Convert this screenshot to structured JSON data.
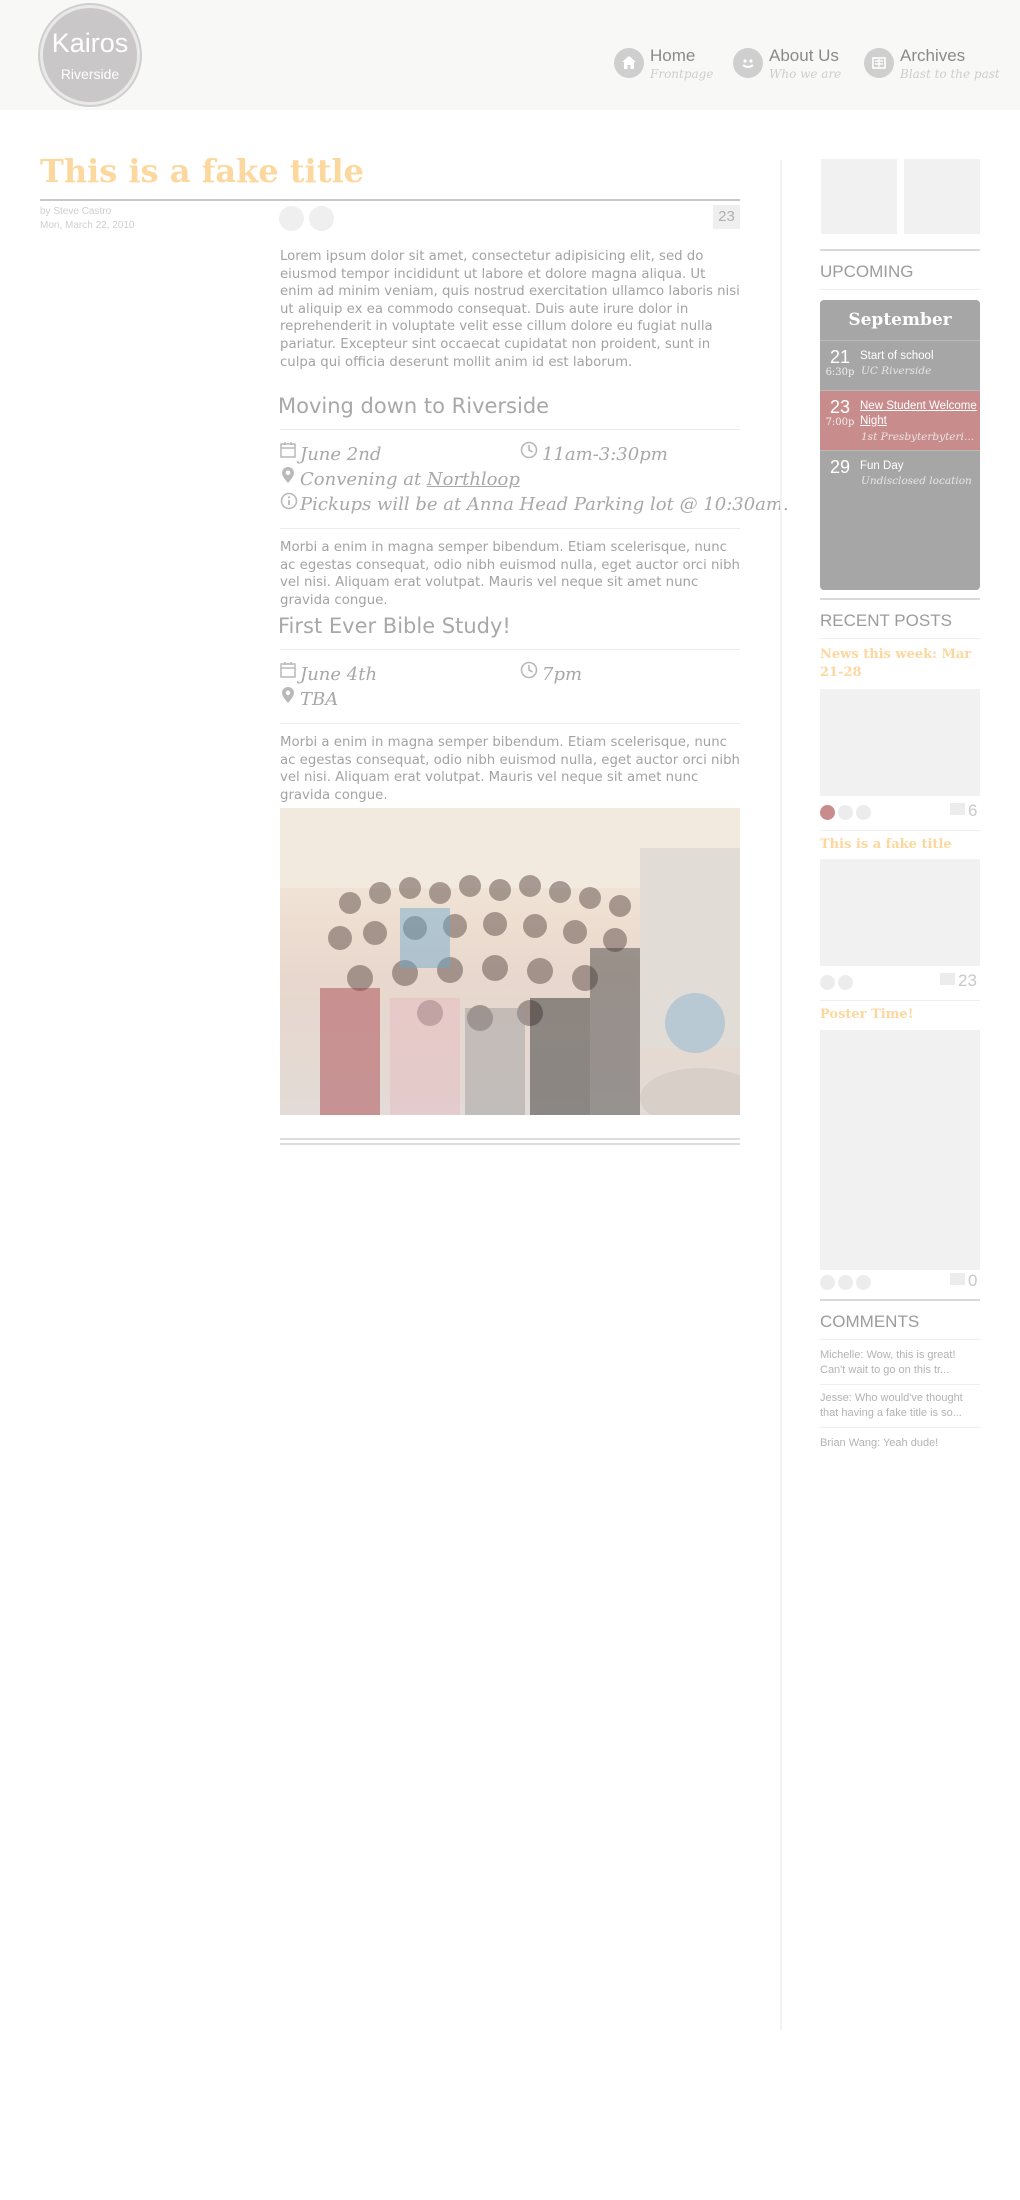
{
  "header": {
    "logo_name": "Kairos",
    "logo_sub": "Riverside",
    "nav": [
      {
        "label": "Home",
        "sub": "Frontpage",
        "icon": "home-icon"
      },
      {
        "label": "About Us",
        "sub": "Who we are",
        "icon": "smiley-icon"
      },
      {
        "label": "Archives",
        "sub": "Blast to the past",
        "icon": "archive-icon"
      }
    ]
  },
  "post": {
    "title": "This is a fake title",
    "author": "by Steve Castro",
    "date": "Mon, March 22, 2010",
    "comment_count": "23",
    "intro": "Lorem ipsum dolor sit amet, consectetur adipisicing elit, sed do eiusmod tempor incididunt ut labore et dolore magna aliqua. Ut enim ad minim veniam, quis nostrud exercitation ullamco laboris nisi ut aliquip ex ea commodo consequat. Duis aute irure dolor in reprehenderit in voluptate velit esse cillum dolore eu fugiat nulla pariatur. Excepteur sint occaecat cupidatat non proident, sunt in culpa qui officia deserunt mollit anim id est laborum.",
    "section1": {
      "heading": "Moving down to Riverside",
      "date": "June 2nd",
      "time": "11am-3:30pm",
      "location_prefix": "Convening at ",
      "location_link": "Northloop",
      "info": "Pickups will be at Anna Head Parking lot @ 10:30am.",
      "body": "Morbi a enim in magna semper bibendum. Etiam scelerisque, nunc ac egestas consequat, odio nibh euismod nulla, eget auctor orci nibh vel nisi. Aliquam erat volutpat. Mauris vel neque sit amet nunc gravida congue."
    },
    "section2": {
      "heading": "First Ever Bible Study!",
      "date": "June 4th",
      "time": "7pm",
      "location": "TBA",
      "body": "Morbi a enim in magna semper bibendum. Etiam scelerisque, nunc ac egestas consequat, odio nibh euismod nulla, eget auctor orci nibh vel nisi. Aliquam erat volutpat. Mauris vel neque sit amet nunc gravida congue."
    }
  },
  "sidebar": {
    "upcoming_heading": "UPCOMING",
    "calendar": {
      "month": "September",
      "events": [
        {
          "day": "21",
          "time": "6:30p",
          "title": "Start of school",
          "location": "UC Riverside"
        },
        {
          "day": "23",
          "time": "7:00p",
          "title": "New Student Welcome Night",
          "location": "1st Presbyterbyterian..."
        },
        {
          "day": "29",
          "time": "",
          "title": "Fun Day",
          "location": "Undisclosed location"
        }
      ],
      "highlight_color": "#c98c8c"
    },
    "recent_heading": "RECENT POSTS",
    "recent_posts": [
      {
        "title": "News this week: Mar 21-28",
        "count": "6"
      },
      {
        "title": "This is a fake title",
        "count": "23"
      },
      {
        "title": "Poster Time!",
        "count": "0"
      }
    ],
    "comments_heading": "COMMENTS",
    "comments": [
      {
        "text": "Michelle: Wow, this is great! Can't wait to go on this tr..."
      },
      {
        "text": "Jesse: Who would've thought that having a fake title is so..."
      },
      {
        "text": "Brian Wang: Yeah dude!"
      }
    ]
  },
  "colors": {
    "title_accent": "#fcd79e",
    "header_bg": "#f8f9f7"
  }
}
